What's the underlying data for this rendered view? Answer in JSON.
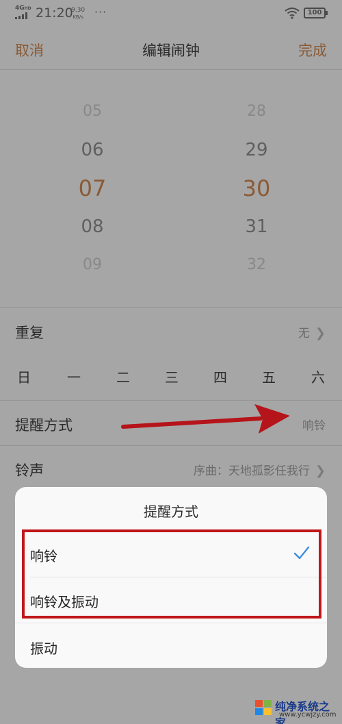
{
  "status_bar": {
    "network": "4G",
    "network_sup": "HD",
    "time": "21:20",
    "speed_value": "9.30",
    "speed_unit": "KB/s",
    "dots": "···",
    "battery": "100"
  },
  "nav": {
    "cancel_label": "取消",
    "title": "编辑闹钟",
    "done_label": "完成"
  },
  "time_picker": {
    "hours": [
      "05",
      "06",
      "07",
      "08",
      "09"
    ],
    "minutes": [
      "28",
      "29",
      "30",
      "31",
      "32"
    ],
    "selected_hour": "07",
    "selected_minute": "30"
  },
  "repeat": {
    "label": "重复",
    "value": "无",
    "weekdays": [
      "日",
      "一",
      "二",
      "三",
      "四",
      "五",
      "六"
    ]
  },
  "reminder": {
    "label": "提醒方式",
    "value": "响铃"
  },
  "ringtone": {
    "label": "铃声",
    "value": "序曲：天地孤影任我行"
  },
  "sheet": {
    "title": "提醒方式",
    "options": [
      {
        "label": "响铃",
        "selected": true
      },
      {
        "label": "响铃及振动",
        "selected": false
      },
      {
        "label": "振动",
        "selected": false
      }
    ]
  },
  "colors": {
    "accent": "#e26a1f",
    "check": "#3b8ee0",
    "annotation_red": "#c0161a"
  },
  "watermark": {
    "name": "纯净系统之家",
    "url": "www.ycwjzy.com"
  }
}
